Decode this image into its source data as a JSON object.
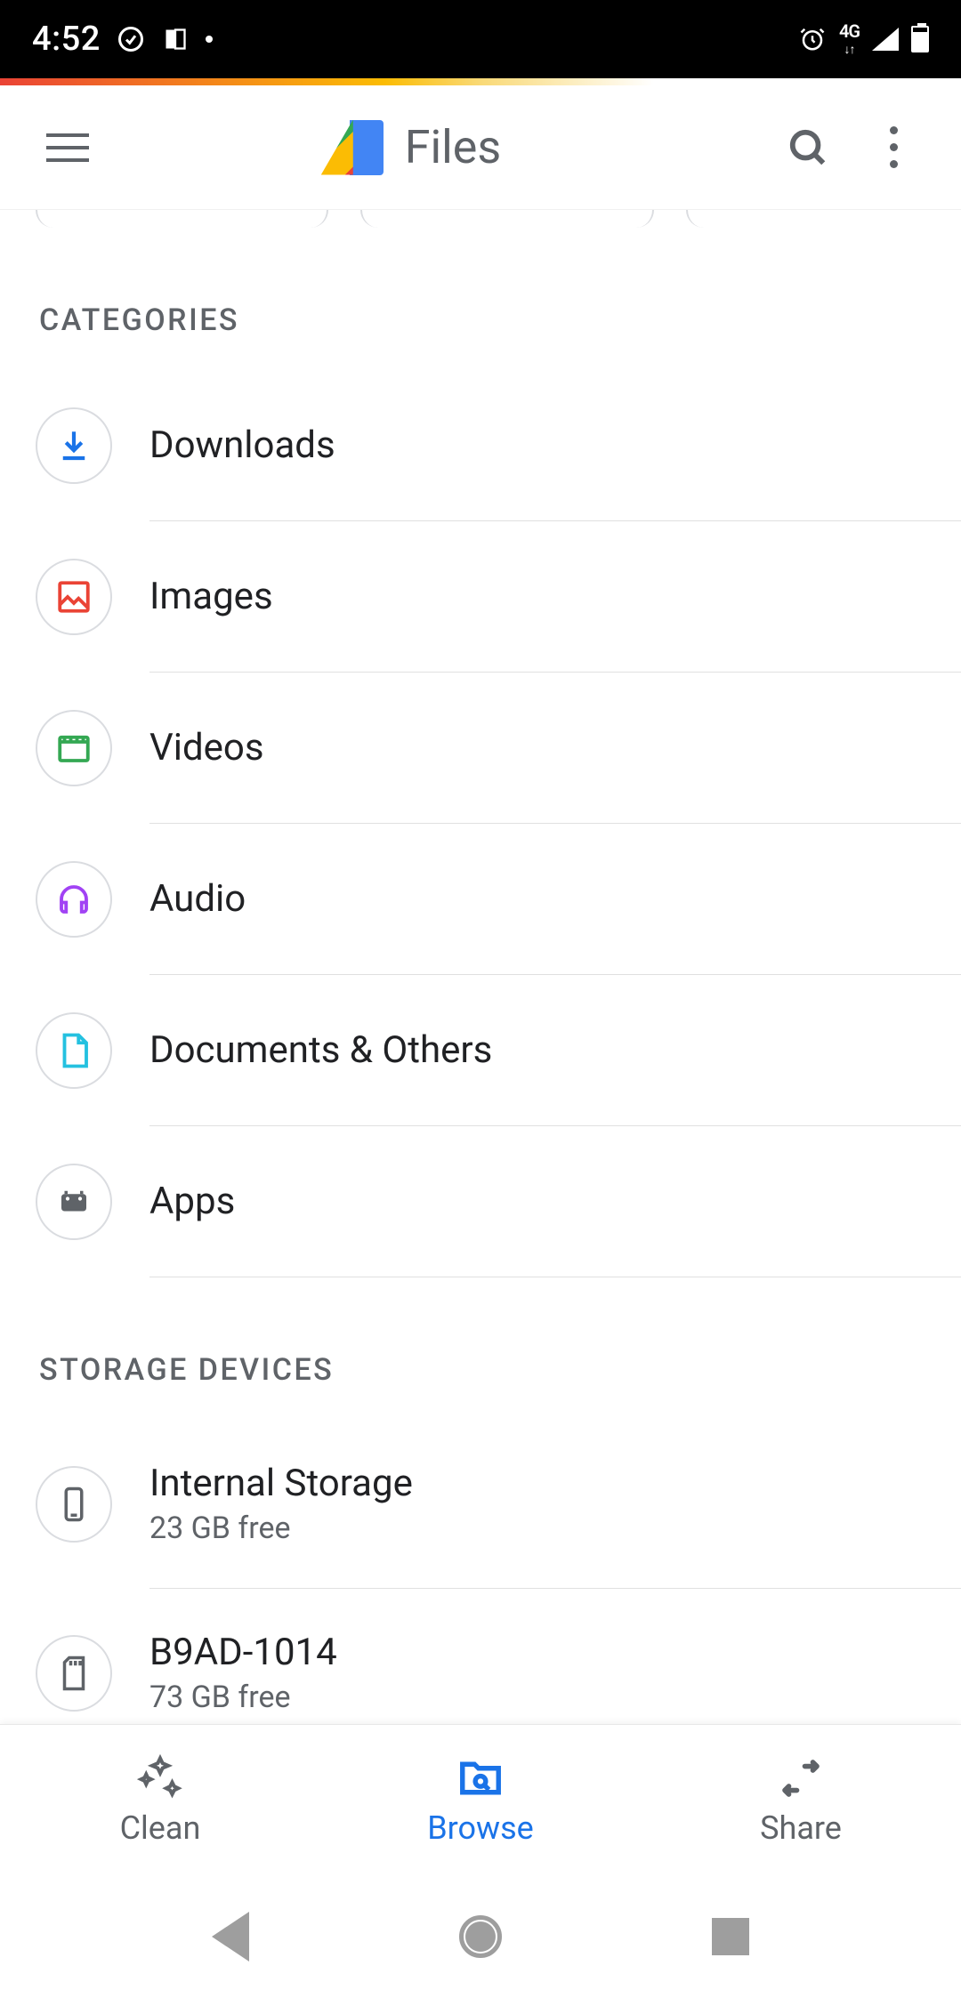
{
  "status": {
    "time": "4:52",
    "network": "4G"
  },
  "app": {
    "title": "Files"
  },
  "sections": {
    "categories_header": "CATEGORIES",
    "categories": [
      {
        "label": "Downloads"
      },
      {
        "label": "Images"
      },
      {
        "label": "Videos"
      },
      {
        "label": "Audio"
      },
      {
        "label": "Documents & Others"
      },
      {
        "label": "Apps"
      }
    ],
    "storage_header": "STORAGE DEVICES",
    "storage": [
      {
        "label": "Internal Storage",
        "sub": "23 GB free"
      },
      {
        "label": "B9AD-1014",
        "sub": "73 GB free"
      }
    ]
  },
  "bottom_nav": {
    "clean": "Clean",
    "browse": "Browse",
    "share": "Share"
  }
}
